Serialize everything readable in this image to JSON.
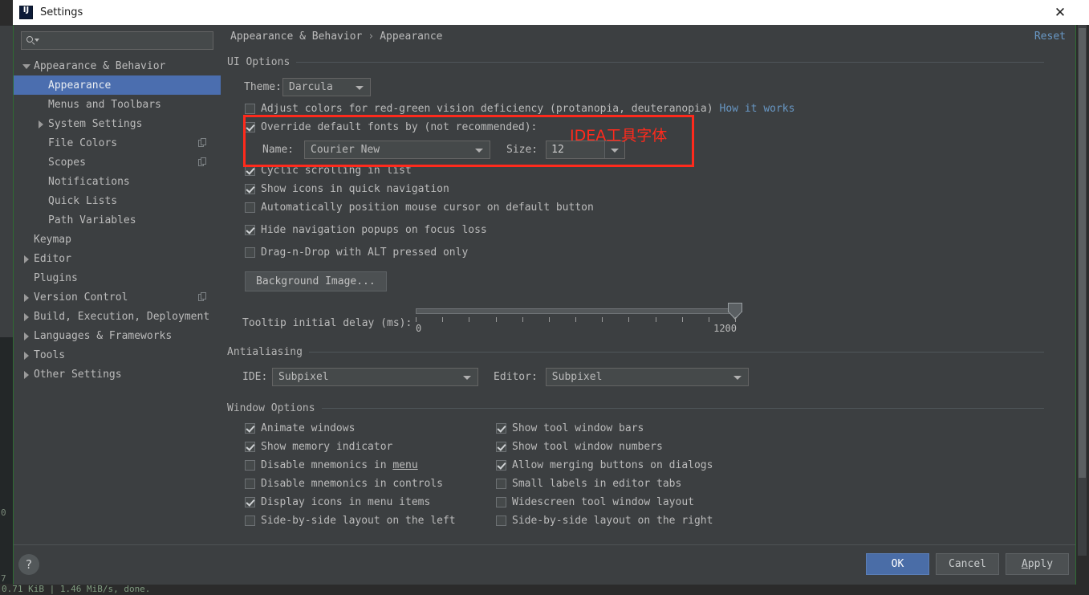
{
  "window": {
    "title": "Settings",
    "icon": "intellij-idea-icon",
    "close_label": "✕"
  },
  "background": {
    "gutter_numbers": [
      "0",
      "7"
    ],
    "status_text": "0.71 KiB | 1.46 MiB/s, done."
  },
  "sidebar": {
    "search": {
      "placeholder": "",
      "value": "",
      "icon": "search-icon"
    },
    "items": [
      {
        "label": "Appearance & Behavior",
        "arrow": "down",
        "indent": 0,
        "selected": false,
        "copy_icon": false
      },
      {
        "label": "Appearance",
        "arrow": "none",
        "indent": 1,
        "selected": true,
        "copy_icon": false
      },
      {
        "label": "Menus and Toolbars",
        "arrow": "none",
        "indent": 1,
        "selected": false,
        "copy_icon": false
      },
      {
        "label": "System Settings",
        "arrow": "right",
        "indent": 1,
        "selected": false,
        "copy_icon": false
      },
      {
        "label": "File Colors",
        "arrow": "none",
        "indent": 1,
        "selected": false,
        "copy_icon": true
      },
      {
        "label": "Scopes",
        "arrow": "none",
        "indent": 1,
        "selected": false,
        "copy_icon": true
      },
      {
        "label": "Notifications",
        "arrow": "none",
        "indent": 1,
        "selected": false,
        "copy_icon": false
      },
      {
        "label": "Quick Lists",
        "arrow": "none",
        "indent": 1,
        "selected": false,
        "copy_icon": false
      },
      {
        "label": "Path Variables",
        "arrow": "none",
        "indent": 1,
        "selected": false,
        "copy_icon": false
      },
      {
        "label": "Keymap",
        "arrow": "none",
        "indent": 0,
        "selected": false,
        "copy_icon": false
      },
      {
        "label": "Editor",
        "arrow": "right",
        "indent": 0,
        "selected": false,
        "copy_icon": false
      },
      {
        "label": "Plugins",
        "arrow": "none",
        "indent": 0,
        "selected": false,
        "copy_icon": false
      },
      {
        "label": "Version Control",
        "arrow": "right",
        "indent": 0,
        "selected": false,
        "copy_icon": true
      },
      {
        "label": "Build, Execution, Deployment",
        "arrow": "right",
        "indent": 0,
        "selected": false,
        "copy_icon": false
      },
      {
        "label": "Languages & Frameworks",
        "arrow": "right",
        "indent": 0,
        "selected": false,
        "copy_icon": false
      },
      {
        "label": "Tools",
        "arrow": "right",
        "indent": 0,
        "selected": false,
        "copy_icon": false
      },
      {
        "label": "Other Settings",
        "arrow": "right",
        "indent": 0,
        "selected": false,
        "copy_icon": false
      }
    ]
  },
  "breadcrumb": {
    "parent": "Appearance & Behavior",
    "separator": "›",
    "current": "Appearance",
    "reset_label": "Reset"
  },
  "ui_options": {
    "group_title": "UI Options",
    "theme_label": "Theme:",
    "theme_value": "Darcula",
    "adjust_colors": {
      "label": "Adjust colors for red-green vision deficiency (protanopia, deuteranopia)",
      "checked": false,
      "link": "How it works"
    },
    "override_fonts": {
      "label": "Override default fonts by (not recommended):",
      "checked": true
    },
    "font_name_label": "Name:",
    "font_name_value": "Courier New",
    "font_size_label": "Size:",
    "font_size_value": "12",
    "checkboxes": [
      {
        "label": "Cyclic scrolling in list",
        "checked": true
      },
      {
        "label": "Show icons in quick navigation",
        "checked": true
      },
      {
        "label": "Automatically position mouse cursor on default button",
        "checked": false
      },
      {
        "label": "Hide navigation popups on focus loss",
        "checked": true
      },
      {
        "label": "Drag-n-Drop with ALT pressed only",
        "checked": false
      }
    ],
    "background_image_button": "Background Image...",
    "tooltip_delay": {
      "label": "Tooltip initial delay (ms):",
      "min": "0",
      "max": "1200",
      "value": 1200,
      "tick_count": 13
    }
  },
  "antialiasing": {
    "group_title": "Antialiasing",
    "ide_label": "IDE:",
    "ide_value": "Subpixel",
    "editor_label": "Editor:",
    "editor_value": "Subpixel"
  },
  "window_options": {
    "group_title": "Window Options",
    "left_column": [
      {
        "label": "Animate windows",
        "checked": true,
        "mnemonic": ""
      },
      {
        "label": "Show memory indicator",
        "checked": true,
        "mnemonic": ""
      },
      {
        "label": "Disable mnemonics in menu",
        "checked": false,
        "mnemonic": "menu"
      },
      {
        "label": "Disable mnemonics in controls",
        "checked": false,
        "mnemonic": ""
      },
      {
        "label": "Display icons in menu items",
        "checked": true,
        "mnemonic": ""
      },
      {
        "label": "Side-by-side layout on the left",
        "checked": false,
        "mnemonic": ""
      }
    ],
    "right_column": [
      {
        "label": "Show tool window bars",
        "checked": true,
        "mnemonic": ""
      },
      {
        "label": "Show tool window numbers",
        "checked": true,
        "mnemonic": ""
      },
      {
        "label": "Allow merging buttons on dialogs",
        "checked": true,
        "mnemonic": ""
      },
      {
        "label": "Small labels in editor tabs",
        "checked": false,
        "mnemonic": ""
      },
      {
        "label": "Widescreen tool window layout",
        "checked": false,
        "mnemonic": ""
      },
      {
        "label": "Side-by-side layout on the right",
        "checked": false,
        "mnemonic": ""
      }
    ]
  },
  "annotation": {
    "text": "IDEA工具字体",
    "color": "#ff2a1c"
  },
  "footer": {
    "help_label": "?",
    "ok_label": "OK",
    "cancel_label": "Cancel",
    "apply_label": "Apply",
    "apply_mnemonic": "A"
  },
  "colors": {
    "accent_selection": "#4b6eaf",
    "panel_bg": "#3c3f41",
    "field_bg": "#45494a",
    "link": "#6897c4",
    "annotation_red": "#ff2a1c",
    "window_border": "#2e6b32"
  }
}
